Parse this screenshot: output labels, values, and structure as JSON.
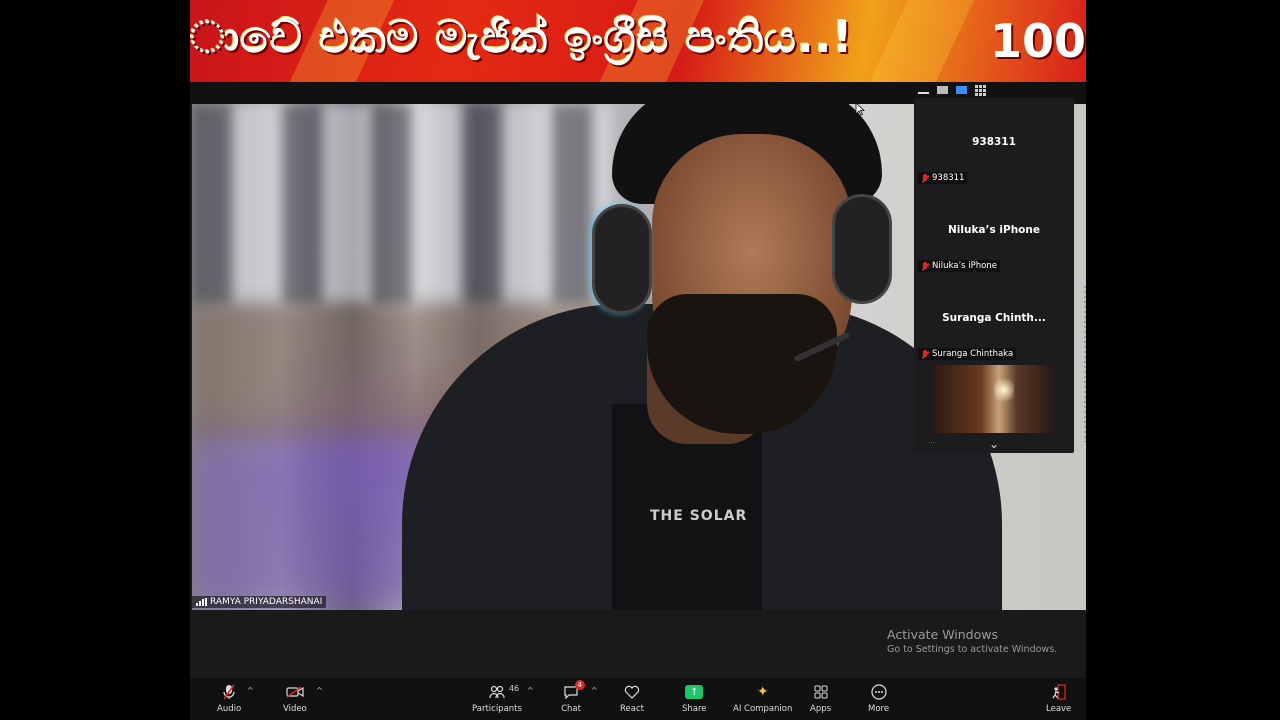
{
  "banner": {
    "text": "ාවේ එකම මැජික් ඉංග්‍රීසි පංතිය..!",
    "number": "100"
  },
  "main_video": {
    "participant_name": "RAMYA PRIYADARSHANAI",
    "shirt_print": "THE SOLAR"
  },
  "gallery": {
    "tiles": [
      {
        "title": "938311",
        "label": "938311"
      },
      {
        "title": "Niluka’s iPhone",
        "label": "Niluka’s iPhone"
      },
      {
        "title": "Suranga  Chinth...",
        "label": "Suranga Chinthaka"
      }
    ],
    "thumb_caption": "...",
    "more_icon": "chevron-down-icon"
  },
  "watermark": {
    "title": "Activate Windows",
    "subtitle": "Go to Settings to activate Windows."
  },
  "toolbar": {
    "audio": "Audio",
    "video": "Video",
    "participants": "Participants",
    "participants_count": "46",
    "chat": "Chat",
    "chat_badge": "4",
    "react": "React",
    "share": "Share",
    "ai_companion": "AI Companion",
    "apps": "Apps",
    "more": "More",
    "leave": "Leave"
  },
  "colors": {
    "share_green": "#1fc56b",
    "muted_red": "#e02828",
    "active_view_blue": "#3b8cff"
  }
}
